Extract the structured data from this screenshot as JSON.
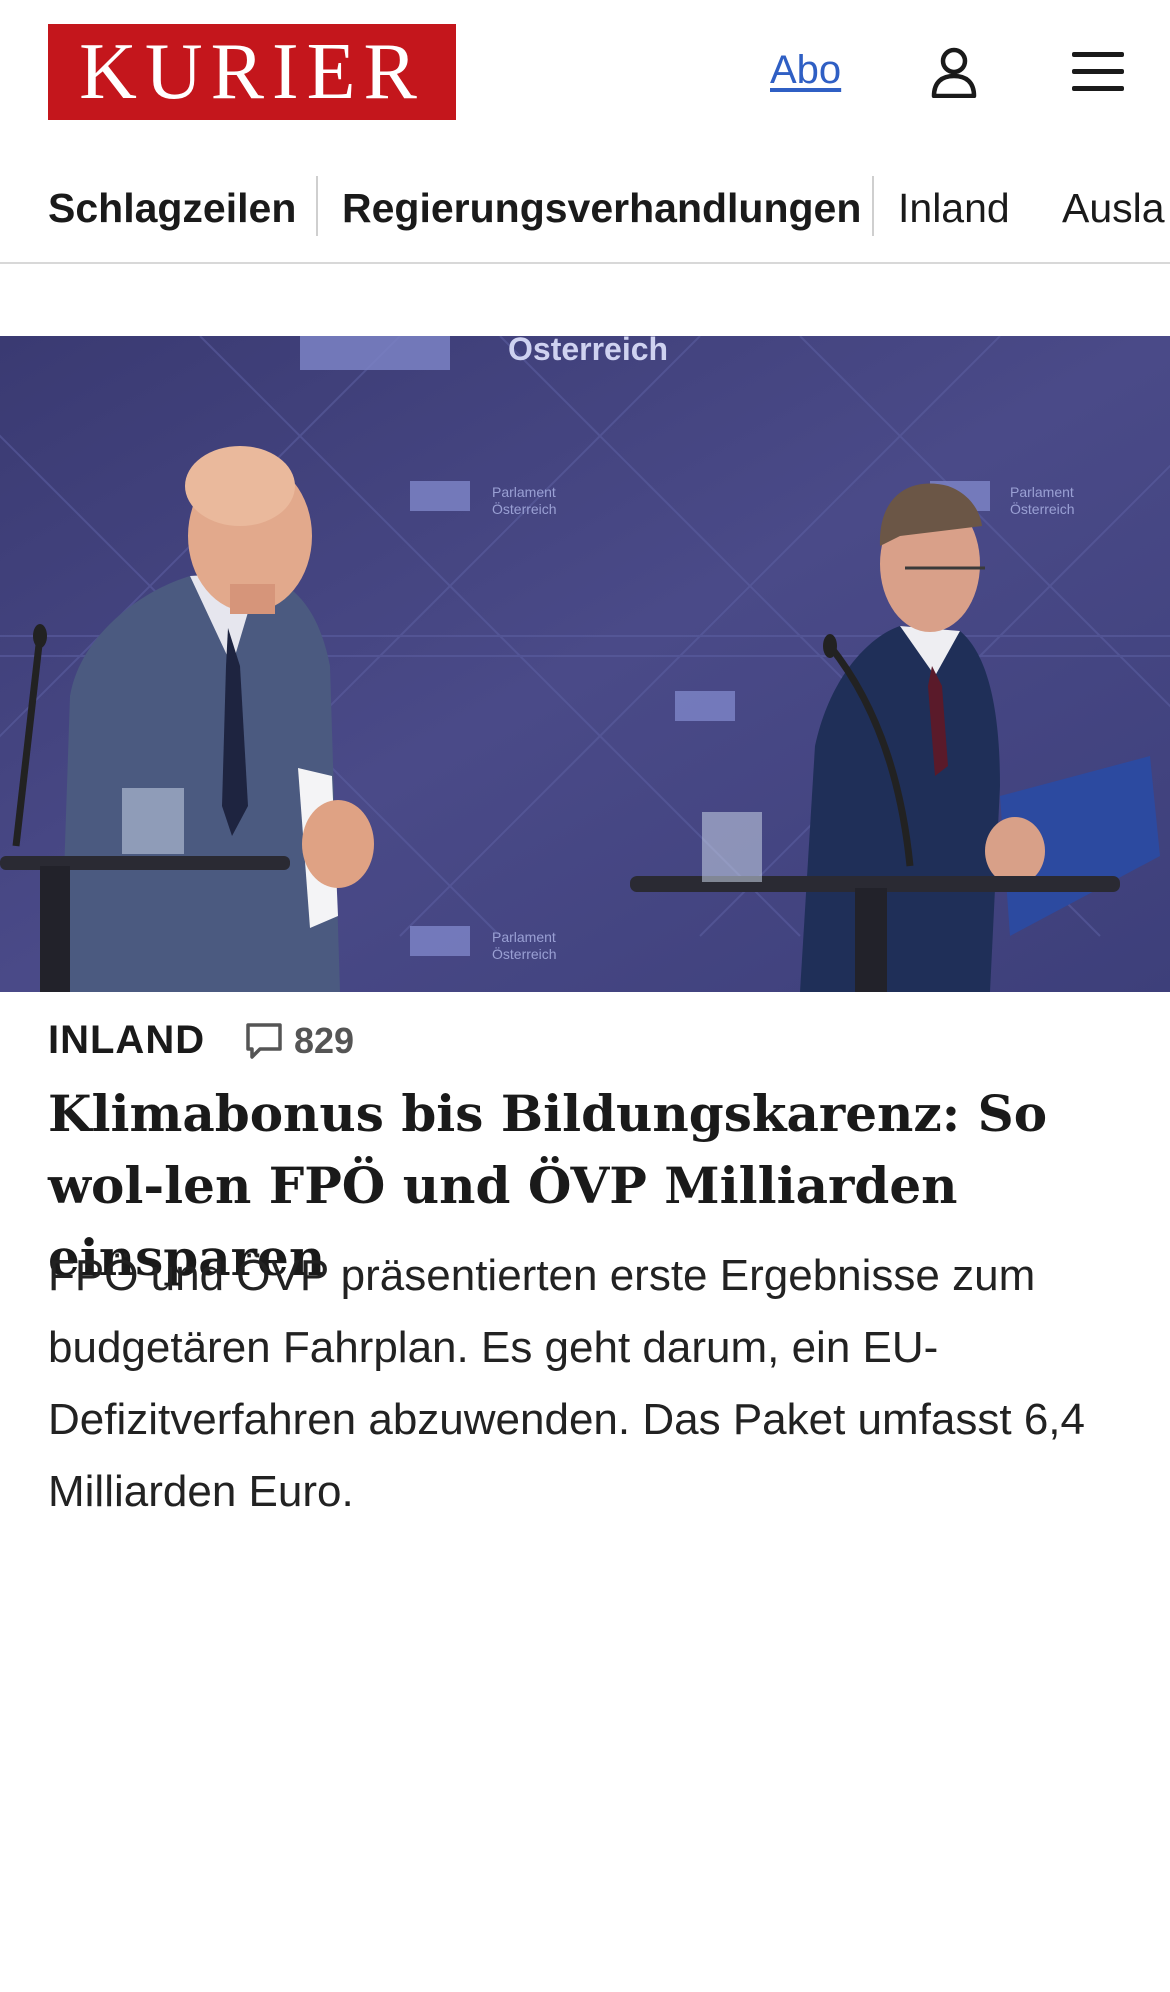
{
  "header": {
    "logo_text": "KURIER",
    "abo_label": "Abo",
    "user_icon": "user-icon",
    "menu_icon": "menu-icon"
  },
  "nav": {
    "items": [
      {
        "label": "Schlagzeilen"
      },
      {
        "label": "Regierungsverhandlungen"
      },
      {
        "label": "Inland"
      },
      {
        "label": "Ausla"
      }
    ]
  },
  "hero": {
    "backdrop_text": "Österreich",
    "logo_caption_1": "Parlament",
    "logo_caption_2": "Österreich"
  },
  "article": {
    "category": "INLAND",
    "comment_icon": "comment-icon",
    "comment_count": "829",
    "headline": "Klimabonus bis Bildungskarenz: So wol-len FPÖ und ÖVP Milliarden einsparen",
    "teaser": "FPÖ und ÖVP präsentierten erste Ergebnisse zum budgetären Fahrplan. Es geht darum, ein EU-Defizitverfahren abzuwenden. Das Paket umfasst 6,4 Milliarden Euro."
  },
  "colors": {
    "brand_red": "#c4161c",
    "link_blue": "#2f5fc4",
    "hero_backdrop": "#3f3f78"
  }
}
